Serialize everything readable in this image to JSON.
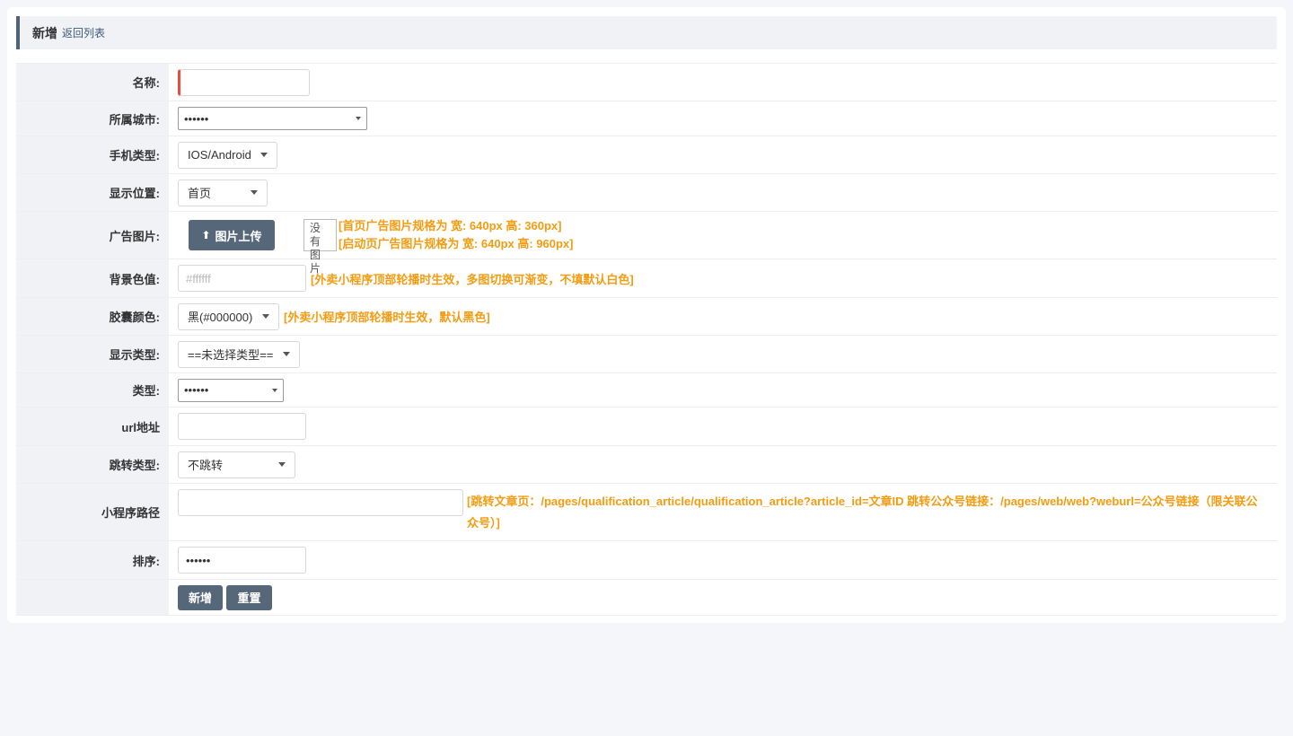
{
  "header": {
    "title": "新增",
    "back_link": "返回列表"
  },
  "fields": {
    "name": {
      "label": "名称:",
      "value": ""
    },
    "city": {
      "label": "所属城市:",
      "selected": "••••••"
    },
    "phone_type": {
      "label": "手机类型:",
      "selected": "IOS/Android"
    },
    "position": {
      "label": "显示位置:",
      "selected": "首页"
    },
    "ad_image": {
      "label": "广告图片:",
      "upload_label": "图片上传",
      "no_image_line1": "没有",
      "no_image_line2": "图片",
      "hint1": "[首页广告图片规格为 宽: 640px 高: 360px]",
      "hint2": "[启动页广告图片规格为 宽: 640px 高: 960px]"
    },
    "bg_color": {
      "label": "背景色值:",
      "placeholder": "#ffffff",
      "hint": "[外卖小程序顶部轮播时生效，多图切换可渐变，不填默认白色]"
    },
    "capsule_color": {
      "label": "胶囊颜色:",
      "selected": "黑(#000000)",
      "hint": "[外卖小程序顶部轮播时生效，默认黑色]"
    },
    "display_type": {
      "label": "显示类型:",
      "selected": "==未选择类型=="
    },
    "type": {
      "label": "类型:",
      "selected": "••••••"
    },
    "url": {
      "label": "url地址",
      "value": ""
    },
    "jump_type": {
      "label": "跳转类型:",
      "selected": "不跳转"
    },
    "mini_path": {
      "label": "小程序路径",
      "value": "",
      "hint": "[跳转文章页：/pages/qualification_article/qualification_article?article_id=文章ID 跳转公众号链接：/pages/web/web?weburl=公众号链接（限关联公众号）]"
    },
    "sort": {
      "label": "排序:",
      "value": "••••••"
    }
  },
  "actions": {
    "submit_label": "新增",
    "reset_label": "重置"
  },
  "colors": {
    "accent": "#56677a",
    "hint": "#f39c12",
    "required": "#e74c3c"
  }
}
